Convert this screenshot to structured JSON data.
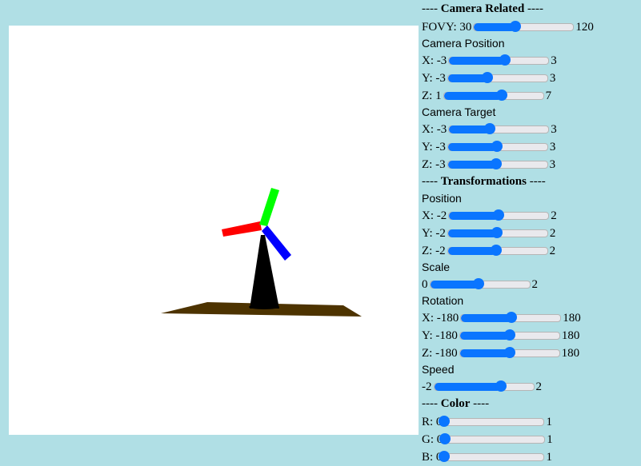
{
  "scene": {
    "ground_color": "#4d3300",
    "tower_color": "#000000",
    "blade_colors": [
      "#ff0000",
      "#00ff00",
      "#0000ff"
    ]
  },
  "camera": {
    "header_prefix": "----",
    "header_title": "Camera Related",
    "header_suffix": "----",
    "fovy": {
      "label": "FOVY: 30",
      "max": "120",
      "value": 0.42
    },
    "position_label": "Camera Position",
    "position": [
      {
        "label": "X: -3",
        "max": "3",
        "value": 0.56
      },
      {
        "label": "Y: -3",
        "max": "3",
        "value": 0.4
      },
      {
        "label": "Z: 1",
        "max": "7",
        "value": 0.58
      }
    ],
    "target_label": "Camera Target",
    "target": [
      {
        "label": "X: -3",
        "max": "3",
        "value": 0.41
      },
      {
        "label": "Y: -3",
        "max": "3",
        "value": 0.49
      },
      {
        "label": "Z: -3",
        "max": "3",
        "value": 0.49
      }
    ]
  },
  "transform": {
    "header_prefix": "----",
    "header_title": "Transformations",
    "header_suffix": "----",
    "position_label": "Position",
    "position": [
      {
        "label": "X: -2",
        "max": "2",
        "value": 0.5
      },
      {
        "label": "Y: -2",
        "max": "2",
        "value": 0.49
      },
      {
        "label": "Z: -2",
        "max": "2",
        "value": 0.49
      }
    ],
    "scale_label": "Scale",
    "scale": {
      "label": "0",
      "max": "2",
      "value": 0.49
    },
    "rotation_label": "Rotation",
    "rotation": [
      {
        "label": "X: -180",
        "max": "180",
        "value": 0.51
      },
      {
        "label": "Y: -180",
        "max": "180",
        "value": 0.5
      },
      {
        "label": "Z: -180",
        "max": "180",
        "value": 0.5
      }
    ],
    "speed_label": "Speed",
    "speed": {
      "label": "-2",
      "max": "2",
      "value": 0.67
    }
  },
  "color": {
    "header_prefix": "----",
    "header_title": "Color",
    "header_suffix": "----",
    "r": {
      "label": "R: 0",
      "max": "1",
      "value": 0.0
    },
    "g": {
      "label": "G: 0",
      "max": "1",
      "value": 0.0
    },
    "b": {
      "label": "B: 0",
      "max": "1",
      "value": 0.0
    }
  }
}
